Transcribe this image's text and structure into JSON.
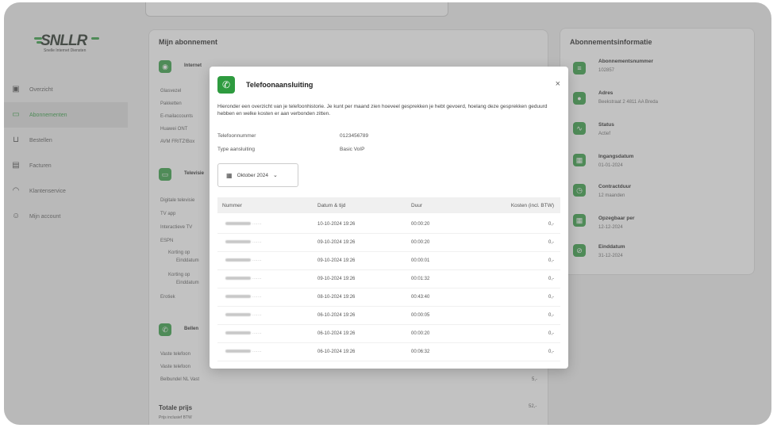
{
  "brand": {
    "name": "SNLLR",
    "tagline": "Snelle Internet Diensten"
  },
  "sidebar": {
    "items": [
      {
        "label": "Overzicht",
        "icon": "grid-icon"
      },
      {
        "label": "Abonnementen",
        "icon": "card-icon",
        "active": true
      },
      {
        "label": "Bestellen",
        "icon": "cart-icon"
      },
      {
        "label": "Facturen",
        "icon": "document-icon"
      },
      {
        "label": "Klantenservice",
        "icon": "headset-icon"
      },
      {
        "label": "Mijn account",
        "icon": "user-icon"
      }
    ]
  },
  "subscription": {
    "title": "Mijn abonnement",
    "sections": [
      {
        "name": "Internet",
        "lines": [
          "Glasvezel",
          "Pakketten",
          "E-mailaccounts",
          "Huawei ONT",
          "AVM FRITZ!Box"
        ]
      },
      {
        "name": "Televisie",
        "lines": [
          "Digitale televisie",
          "TV app",
          "Interactieve TV",
          "ESPN",
          "Korting op",
          "Einddatum",
          "Korting op",
          "Einddatum",
          "Erotiek"
        ]
      },
      {
        "name": "Bellen",
        "lines": [
          "Vaste telefoon",
          "Vaste telefoon",
          "Belbundel NL Vast"
        ]
      }
    ],
    "belbundel_price": "5,-",
    "total_label": "Totale prijs",
    "total_sub": "Prijs inclusief BTW",
    "total_value": "52,-"
  },
  "info_card": {
    "title": "Abonnementsinformatie",
    "fields": [
      {
        "label": "Abonnementsnummer",
        "value": "102857",
        "icon": "list-icon"
      },
      {
        "label": "Adres",
        "value": "Beekstraat 2 4811 AA Breda",
        "icon": "pin-icon"
      },
      {
        "label": "Status",
        "value": "Actief",
        "icon": "activity-icon"
      },
      {
        "label": "Ingangsdatum",
        "value": "01-01-2024",
        "icon": "calendar-icon"
      },
      {
        "label": "Contractduur",
        "value": "12 maanden",
        "icon": "clock-icon"
      },
      {
        "label": "Opzegbaar per",
        "value": "12-12-2024",
        "icon": "calendar-icon"
      },
      {
        "label": "Einddatum",
        "value": "31-12-2024",
        "icon": "stop-icon"
      }
    ]
  },
  "modal": {
    "title": "Telefoonaansluiting",
    "description": "Hieronder een overzicht van je telefoonhistorie. Je kunt per maand zien hoeveel gesprekken je hebt gevoerd, hoelang deze gesprekken geduurd hebben en welke kosten er aan verbonden zitten.",
    "phone_label": "Telefoonnummer",
    "phone_value": "0123456789",
    "type_label": "Type aansluiting",
    "type_value": "Basic VoIP",
    "month": "Oktober 2024",
    "columns": [
      "Nummer",
      "Datum & tijd",
      "Duur",
      "Kosten (incl. BTW)"
    ],
    "rows": [
      {
        "date": "10-10-2024 19:26",
        "duration": "00:00:20",
        "cost": "0,-"
      },
      {
        "date": "09-10-2024 19:26",
        "duration": "00:00:20",
        "cost": "0,-"
      },
      {
        "date": "09-10-2024 19:26",
        "duration": "00:00:01",
        "cost": "0,-"
      },
      {
        "date": "09-10-2024 19:26",
        "duration": "00:01:32",
        "cost": "0,-"
      },
      {
        "date": "08-10-2024 19:26",
        "duration": "00:43:40",
        "cost": "0,-"
      },
      {
        "date": "06-10-2024 19:26",
        "duration": "00:00:05",
        "cost": "0,-"
      },
      {
        "date": "06-10-2024 19:26",
        "duration": "00:00:20",
        "cost": "0,-"
      },
      {
        "date": "06-10-2024 19:26",
        "duration": "00:06:32",
        "cost": "0,-"
      }
    ]
  }
}
